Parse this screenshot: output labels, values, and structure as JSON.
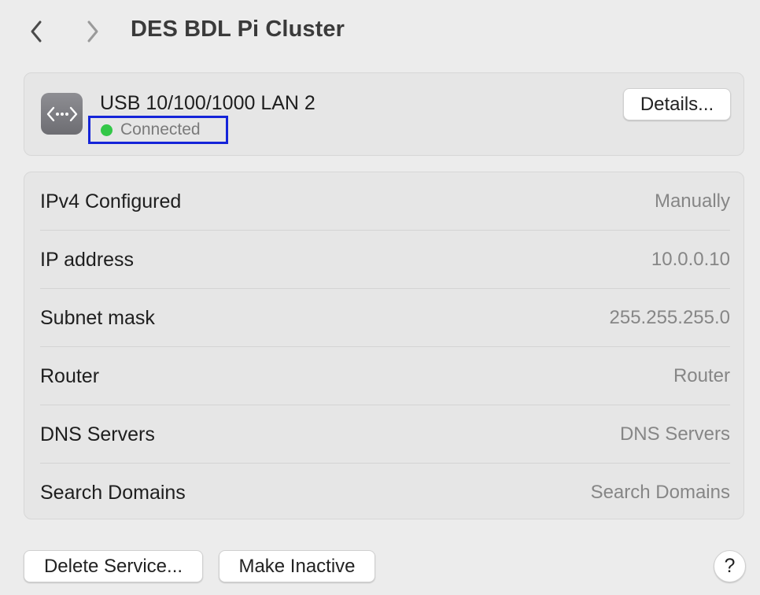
{
  "header": {
    "title": "DES BDL Pi Cluster",
    "back_icon": "chevron-left-icon",
    "forward_icon": "chevron-right-icon"
  },
  "interface": {
    "icon": "ethernet-icon",
    "name": "USB 10/100/1000 LAN 2",
    "status": "Connected",
    "status_color": "#33c748",
    "details_label": "Details..."
  },
  "settings": {
    "rows": [
      {
        "label": "IPv4 Configured",
        "value": "Manually"
      },
      {
        "label": "IP address",
        "value": "10.0.0.10"
      },
      {
        "label": "Subnet mask",
        "value": "255.255.255.0"
      },
      {
        "label": "Router",
        "value": "Router"
      },
      {
        "label": "DNS Servers",
        "value": "DNS Servers"
      },
      {
        "label": "Search Domains",
        "value": "Search Domains"
      }
    ]
  },
  "footer": {
    "delete_label": "Delete Service...",
    "inactive_label": "Make Inactive",
    "help_label": "?"
  },
  "colors": {
    "highlight_box": "#1524d9",
    "background": "#ececec"
  }
}
